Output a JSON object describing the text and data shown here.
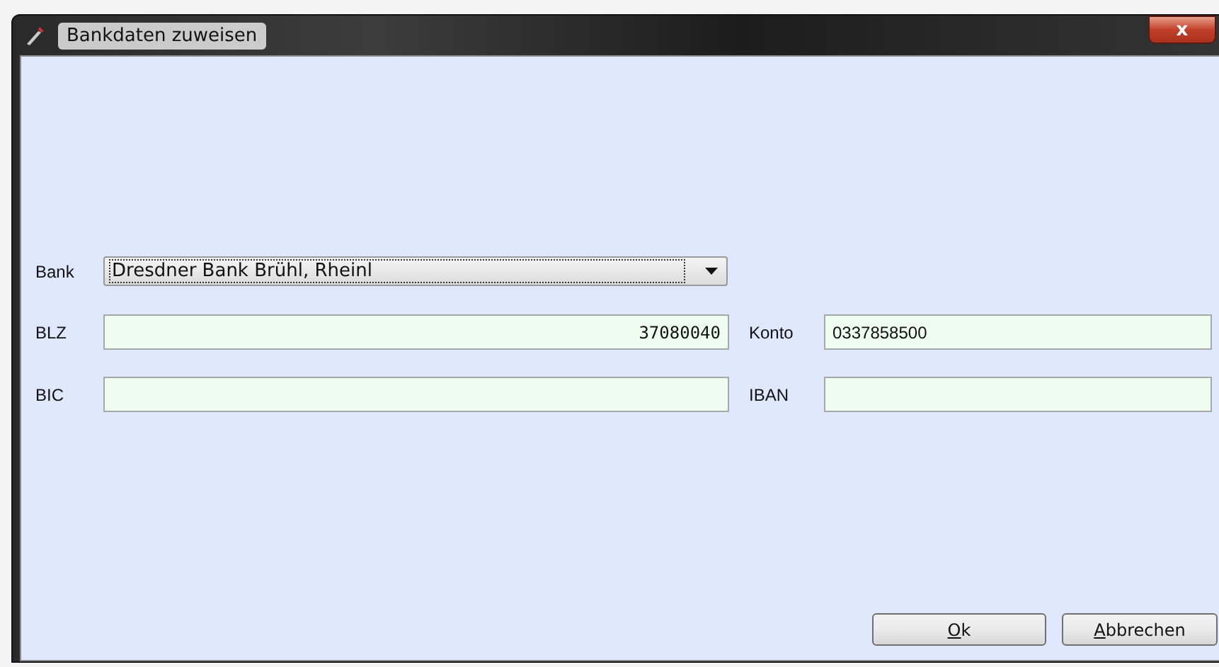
{
  "window": {
    "title": "Bankdaten zuweisen",
    "close": "x"
  },
  "form": {
    "bank": {
      "label": "Bank",
      "value": "Dresdner Bank Brühl, Rheinl"
    },
    "fields": [
      {
        "label": "BLZ",
        "value": "37080040",
        "kind": "number"
      },
      {
        "label": "Konto",
        "value": "0337858500",
        "kind": "text"
      },
      {
        "label": "BIC",
        "kind": "text"
      },
      {
        "label": "IBAN",
        "kind": "text"
      }
    ]
  },
  "buttons": [
    {
      "label": "Ok"
    },
    {
      "label": "Abbrechen"
    }
  ]
}
